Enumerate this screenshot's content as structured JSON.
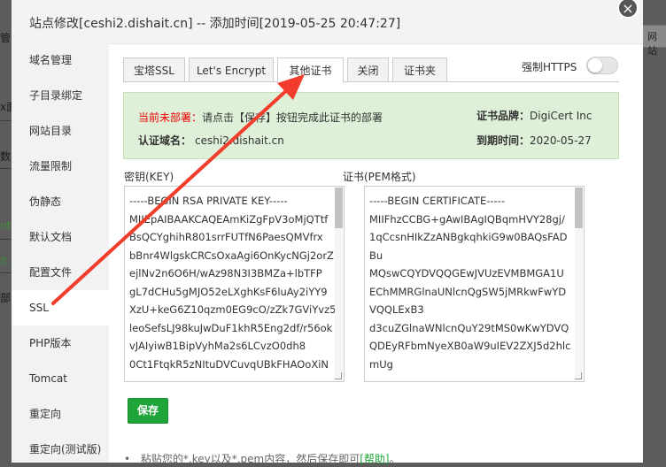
{
  "background": {
    "frag1": "管",
    "frag2": "x面",
    "frag3": "数",
    "frag4": "nt",
    "frag5": "it.c",
    "frag6": "部分",
    "box_label": "网站"
  },
  "dialog": {
    "title": "站点修改[ceshi2.dishait.cn] -- 添加时间[2019-05-25 20:47:27]",
    "close_glyph": "×"
  },
  "sidebar": {
    "items": [
      {
        "label": "域名管理"
      },
      {
        "label": "子目录绑定"
      },
      {
        "label": "网站目录"
      },
      {
        "label": "流量限制"
      },
      {
        "label": "伪静态"
      },
      {
        "label": "默认文档"
      },
      {
        "label": "配置文件"
      },
      {
        "label": "SSL"
      },
      {
        "label": "PHP版本"
      },
      {
        "label": "Tomcat"
      },
      {
        "label": "重定向"
      },
      {
        "label": "重定向(测试版)"
      }
    ],
    "active_index": 7
  },
  "tabs": [
    {
      "label": "宝塔SSL"
    },
    {
      "label": "Let's Encrypt"
    },
    {
      "label": "其他证书"
    },
    {
      "label": "关闭"
    },
    {
      "label": "证书夹"
    }
  ],
  "force_https": {
    "label": "强制HTTPS",
    "enabled": false
  },
  "info": {
    "status_label": "当前未部署：",
    "status_text": "请点击【保存】按钮完成此证书的部署",
    "brand_label": "证书品牌：",
    "brand_value": "DigiCert Inc",
    "domain_label": "认证域名：",
    "domain_value": "ceshi2.dishait.cn",
    "expiry_label": "到期时间：",
    "expiry_value": "2020-05-27"
  },
  "key_field": {
    "label": "密钥(KEY)",
    "lines": [
      "-----BEGIN RSA PRIVATE KEY-----",
      "MIIEpAIBAAKCAQEAmKiZgFpV3oMjQTtf",
      "BsQCYghihR801srrFUTfN6PaesQMVfrx",
      "bBnr4WlgskCRCsOxaAgi6OnKycNGj2orZ",
      "ejlNv2n6O6H/wAz98N3I3BMZa+lbTFP",
      "gL7dCHu5gMJO52eLXghKsF6luAy2iYY9",
      "XzU+keG6Z10qzm0EG9cO/zZk7GViYvz5",
      "leoSefsLJ98kuJwDuF1khR5Eng2df/r56ok",
      "vJAIyiwB1BipVyhMa2s6LCvzO0dh8",
      "0Ct1FtqkR5zNItuDVCuvqUBkFHAOoXiN"
    ]
  },
  "cert_field": {
    "label": "证书(PEM格式)",
    "lines": [
      "-----BEGIN CERTIFICATE-----",
      "MIIFhzCCBG+gAwIBAgIQBqmHVY28gj/",
      "1qCcsnHIkZzANBgkqhkiG9w0BAQsFAD",
      "Bu",
      "MQswCQYDVQQGEwJVUzEVMBMGA1U",
      "EChMMRGlnaUNlcnQgSW5jMRkwFwYD",
      "VQQLExB3",
      "d3cuZGlnaWNlcnQuY29tMS0wKwYDVQ",
      "QDEyRFbmNyeXB0aW9uIEV2ZXJ5d2hlc",
      "mUg"
    ]
  },
  "save_label": "保存",
  "hint": {
    "bullet": "•",
    "text": "粘贴您的*.key以及*.pem内容，然后保存即可",
    "link": "[帮助]",
    "end": "。"
  },
  "colors": {
    "accent": "#20a53a",
    "warn": "#e00000",
    "arrow": "#f23c2c",
    "info_bg": "#dff0d8"
  }
}
